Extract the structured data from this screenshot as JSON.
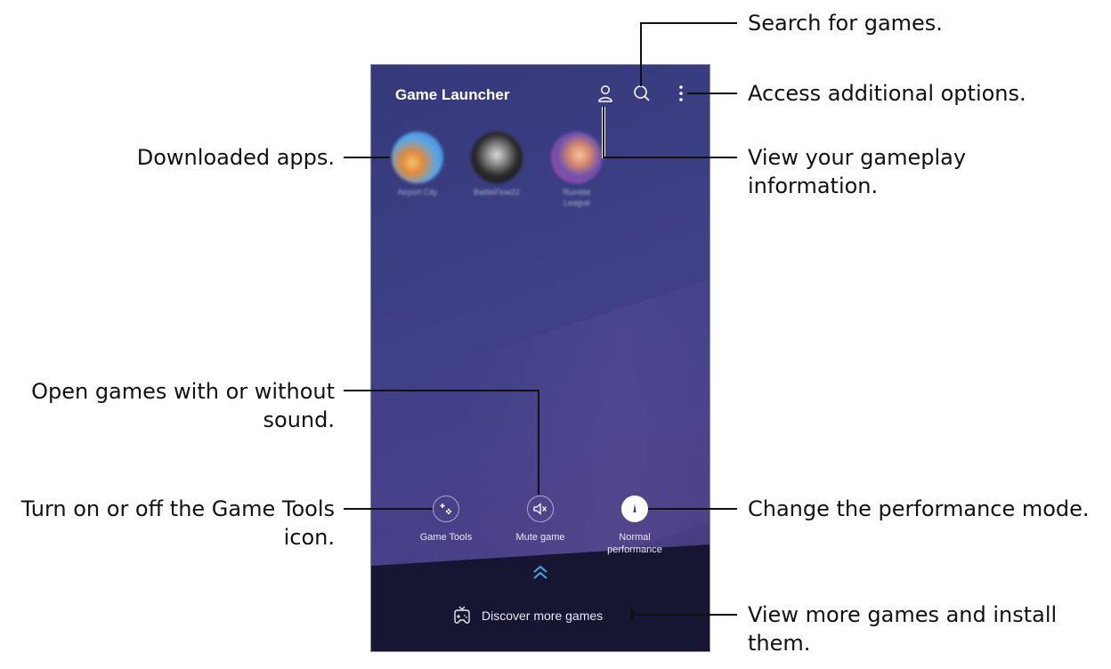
{
  "header": {
    "title": "Game Launcher"
  },
  "apps": [
    {
      "label": "Airport City"
    },
    {
      "label": "BattleFlow22"
    },
    {
      "label": "Rumble League"
    }
  ],
  "tools": {
    "game_tools": "Game Tools",
    "mute_game": "Mute game",
    "performance": "Normal performance"
  },
  "footer": {
    "discover": "Discover more games"
  },
  "callouts": {
    "search": "Search for games.",
    "options": "Access additional options.",
    "gameplay_line1": "View your gameplay",
    "gameplay_line2": "information.",
    "downloaded": "Downloaded apps.",
    "sound_line1": "Open games with or without",
    "sound_line2": "sound.",
    "gametools_line1": "Turn on or off the Game Tools",
    "gametools_line2": "icon.",
    "performance": "Change the performance mode.",
    "more_line1": "View more games and install",
    "more_line2": "them."
  },
  "colors": {
    "background_top": "#35397a",
    "background_bottom": "#161632",
    "accent_chevron": "#4fa3e0",
    "text_dark": "#111111"
  },
  "icons": [
    "profile-icon",
    "search-icon",
    "more-vert-icon",
    "gamepad-icon",
    "mute-icon",
    "performance-icon",
    "chevron-up-icon",
    "game-tv-icon"
  ]
}
